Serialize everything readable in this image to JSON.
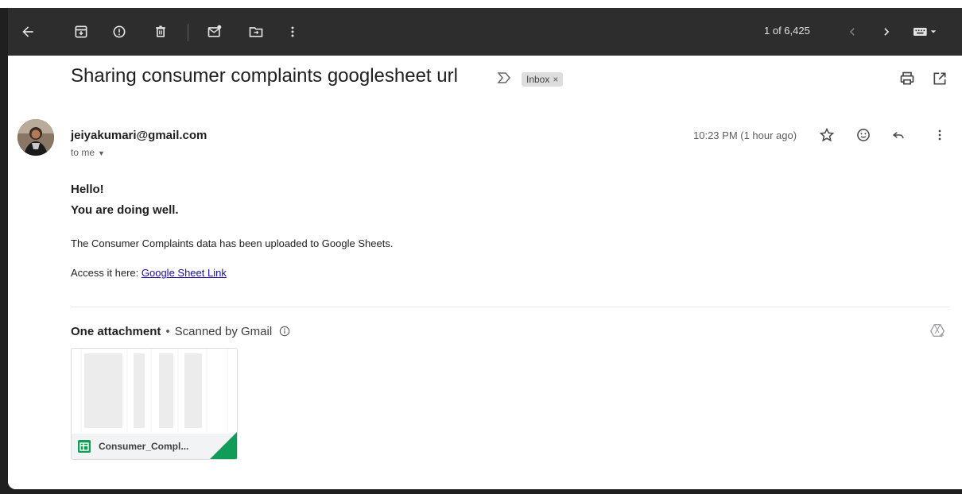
{
  "toolbar": {
    "counter": "1 of 6,425",
    "icons": [
      "back-arrow-icon",
      "archive-icon",
      "report-spam-icon",
      "delete-icon",
      "mark-unread-icon",
      "move-to-icon",
      "more-vert-icon",
      "older-icon",
      "newer-icon",
      "keyboard-icon"
    ]
  },
  "email": {
    "subject": "Sharing consumer complaints googlesheet url",
    "label": "Inbox",
    "label_remove": "×",
    "sender": "jeiyakumari@gmail.com",
    "to_me": "to me",
    "time": "10:23 PM (1 hour ago)",
    "body": {
      "greeting1": "Hello!",
      "greeting2": "You are doing well.",
      "line1": "The Consumer Complaints data has been uploaded to Google Sheets.",
      "line2_prefix": "Access it here: ",
      "link_text": "Google Sheet Link"
    }
  },
  "attachments": {
    "header_bold": "One attachment",
    "separator": "•",
    "scanned_text": "Scanned by Gmail",
    "file_name": "Consumer_Compl..."
  },
  "colors": {
    "toolbar_bg": "#2d2d2d",
    "link": "#1a0dab",
    "sheets_green": "#0f9d58"
  }
}
